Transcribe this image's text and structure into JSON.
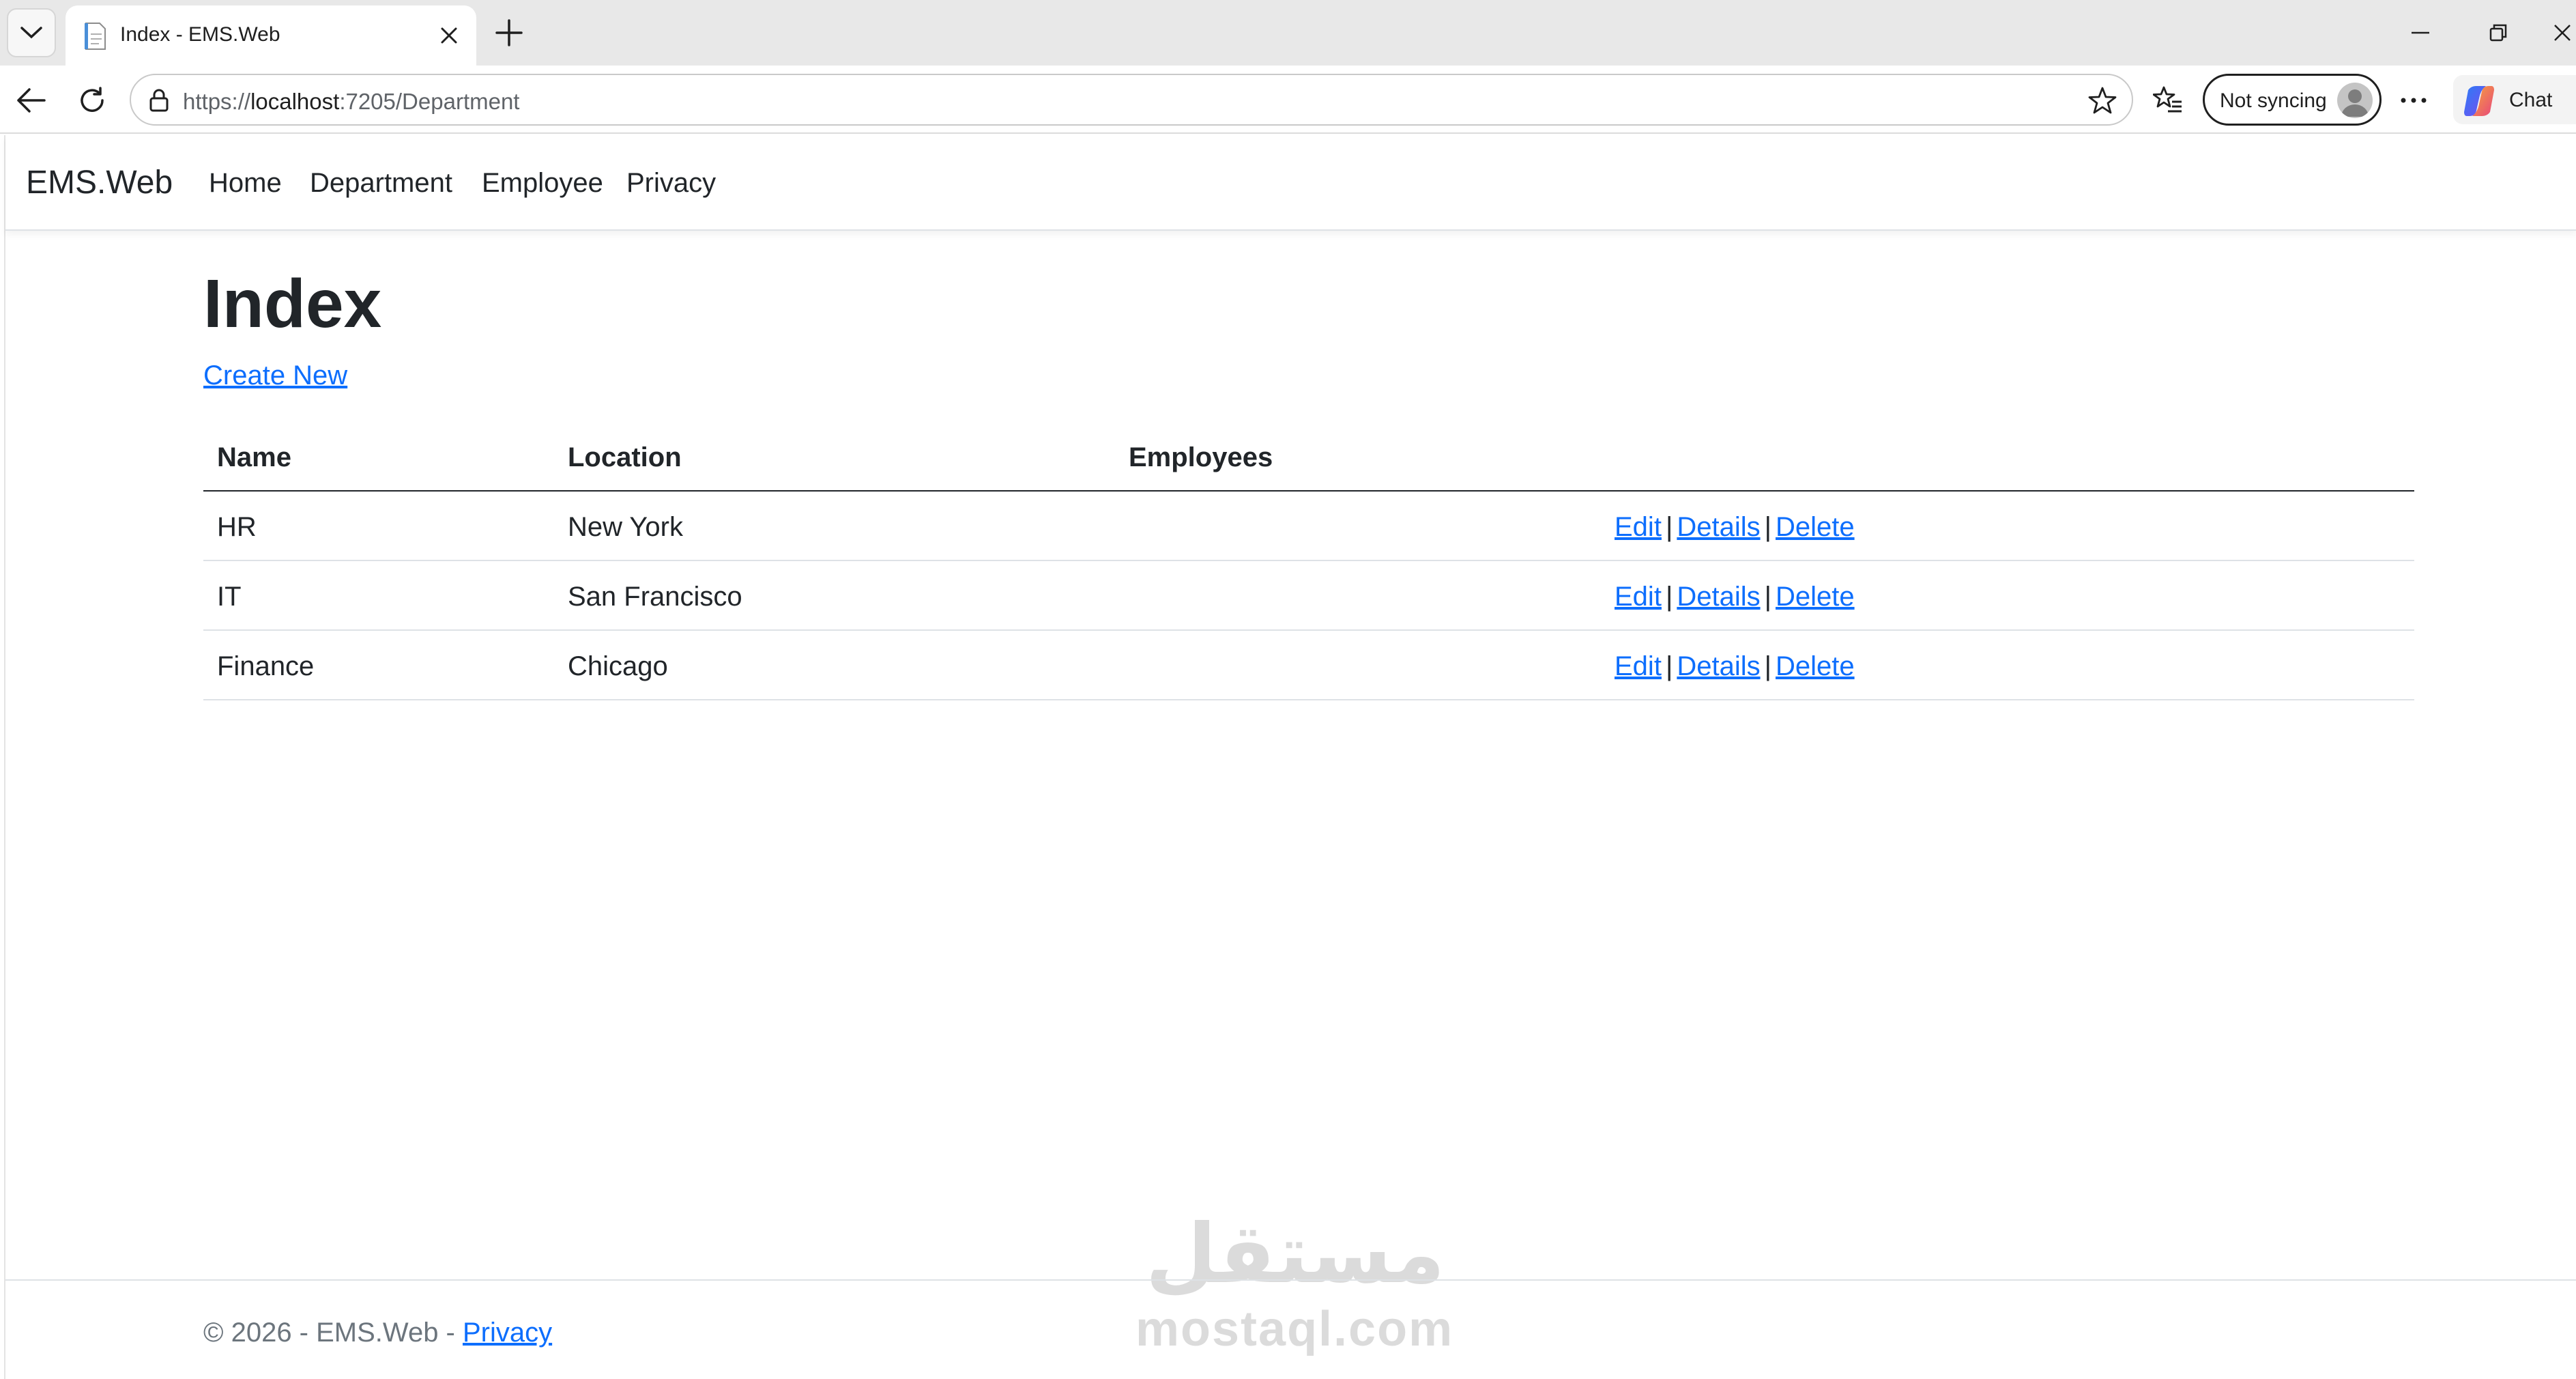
{
  "browser": {
    "tab_title": "Index - EMS.Web",
    "url_scheme": "https://",
    "url_host": "localhost",
    "url_rest": ":7205/Department",
    "profile_label": "Not syncing",
    "chat_label": "Chat"
  },
  "nav": {
    "brand": "EMS.Web",
    "links": [
      "Home",
      "Department",
      "Employee",
      "Privacy"
    ]
  },
  "main": {
    "title": "Index",
    "create_link": "Create New",
    "columns": [
      "Name",
      "Location",
      "Employees"
    ],
    "rows": [
      {
        "name": "HR",
        "location": "New York",
        "employees": ""
      },
      {
        "name": "IT",
        "location": "San Francisco",
        "employees": ""
      },
      {
        "name": "Finance",
        "location": "Chicago",
        "employees": ""
      }
    ],
    "actions": {
      "edit": "Edit",
      "details": "Details",
      "delete": "Delete",
      "separator": "|"
    }
  },
  "footer": {
    "text": "© 2026 - EMS.Web - ",
    "privacy": "Privacy"
  },
  "watermark": {
    "arabic": "مستقل",
    "latin": "mostaql.com"
  }
}
